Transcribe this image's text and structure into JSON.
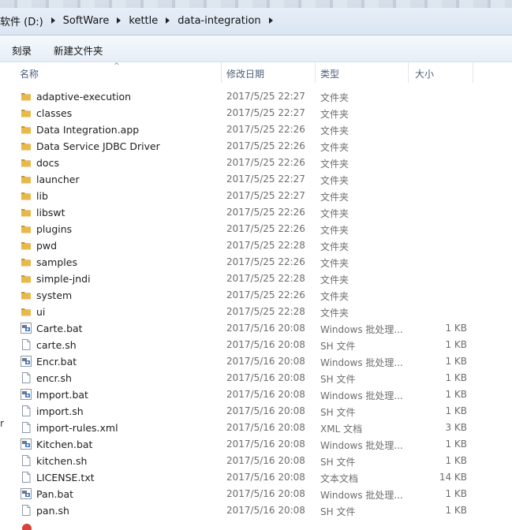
{
  "address": {
    "crumbs": [
      "软件 (D:)",
      "SoftWare",
      "kettle",
      "data-integration"
    ]
  },
  "toolbar": {
    "burn_label": "刻录",
    "new_folder_label": "新建文件夹"
  },
  "columns": {
    "name": "名称",
    "date": "修改日期",
    "type": "类型",
    "size": "大小"
  },
  "left_edge_char": "r",
  "files": [
    {
      "name": "adaptive-execution",
      "date": "2017/5/25 22:27",
      "type": "文件夹",
      "size": "",
      "icon": "folder-icon"
    },
    {
      "name": "classes",
      "date": "2017/5/25 22:27",
      "type": "文件夹",
      "size": "",
      "icon": "folder-icon"
    },
    {
      "name": "Data Integration.app",
      "date": "2017/5/25 22:26",
      "type": "文件夹",
      "size": "",
      "icon": "folder-icon"
    },
    {
      "name": "Data Service JDBC Driver",
      "date": "2017/5/25 22:26",
      "type": "文件夹",
      "size": "",
      "icon": "folder-icon"
    },
    {
      "name": "docs",
      "date": "2017/5/25 22:26",
      "type": "文件夹",
      "size": "",
      "icon": "folder-icon"
    },
    {
      "name": "launcher",
      "date": "2017/5/25 22:27",
      "type": "文件夹",
      "size": "",
      "icon": "folder-icon"
    },
    {
      "name": "lib",
      "date": "2017/5/25 22:27",
      "type": "文件夹",
      "size": "",
      "icon": "folder-icon"
    },
    {
      "name": "libswt",
      "date": "2017/5/25 22:26",
      "type": "文件夹",
      "size": "",
      "icon": "folder-icon"
    },
    {
      "name": "plugins",
      "date": "2017/5/25 22:26",
      "type": "文件夹",
      "size": "",
      "icon": "folder-icon"
    },
    {
      "name": "pwd",
      "date": "2017/5/25 22:28",
      "type": "文件夹",
      "size": "",
      "icon": "folder-icon"
    },
    {
      "name": "samples",
      "date": "2017/5/25 22:26",
      "type": "文件夹",
      "size": "",
      "icon": "folder-icon"
    },
    {
      "name": "simple-jndi",
      "date": "2017/5/25 22:28",
      "type": "文件夹",
      "size": "",
      "icon": "folder-icon"
    },
    {
      "name": "system",
      "date": "2017/5/25 22:26",
      "type": "文件夹",
      "size": "",
      "icon": "folder-icon"
    },
    {
      "name": "ui",
      "date": "2017/5/25 22:28",
      "type": "文件夹",
      "size": "",
      "icon": "folder-icon"
    },
    {
      "name": "Carte.bat",
      "date": "2017/5/16 20:08",
      "type": "Windows 批处理...",
      "size": "1 KB",
      "icon": "batch-file-icon"
    },
    {
      "name": "carte.sh",
      "date": "2017/5/16 20:08",
      "type": "SH 文件",
      "size": "1 KB",
      "icon": "file-icon"
    },
    {
      "name": "Encr.bat",
      "date": "2017/5/16 20:08",
      "type": "Windows 批处理...",
      "size": "1 KB",
      "icon": "batch-file-icon"
    },
    {
      "name": "encr.sh",
      "date": "2017/5/16 20:08",
      "type": "SH 文件",
      "size": "1 KB",
      "icon": "file-icon"
    },
    {
      "name": "Import.bat",
      "date": "2017/5/16 20:08",
      "type": "Windows 批处理...",
      "size": "1 KB",
      "icon": "batch-file-icon"
    },
    {
      "name": "import.sh",
      "date": "2017/5/16 20:08",
      "type": "SH 文件",
      "size": "1 KB",
      "icon": "file-icon"
    },
    {
      "name": "import-rules.xml",
      "date": "2017/5/16 20:08",
      "type": "XML 文档",
      "size": "3 KB",
      "icon": "xml-file-icon"
    },
    {
      "name": "Kitchen.bat",
      "date": "2017/5/16 20:08",
      "type": "Windows 批处理...",
      "size": "1 KB",
      "icon": "batch-file-icon"
    },
    {
      "name": "kitchen.sh",
      "date": "2017/5/16 20:08",
      "type": "SH 文件",
      "size": "1 KB",
      "icon": "file-icon"
    },
    {
      "name": "LICENSE.txt",
      "date": "2017/5/16 20:08",
      "type": "文本文档",
      "size": "14 KB",
      "icon": "text-file-icon"
    },
    {
      "name": "Pan.bat",
      "date": "2017/5/16 20:08",
      "type": "Windows 批处理...",
      "size": "1 KB",
      "icon": "batch-file-icon"
    },
    {
      "name": "pan.sh",
      "date": "2017/5/16 20:08",
      "type": "SH 文件",
      "size": "1 KB",
      "icon": "file-icon"
    }
  ],
  "colors": {
    "folder": "#e8b94a",
    "folder_dark": "#c8962c",
    "header_text": "#4c607a",
    "meta_text": "#6d6d6d"
  }
}
